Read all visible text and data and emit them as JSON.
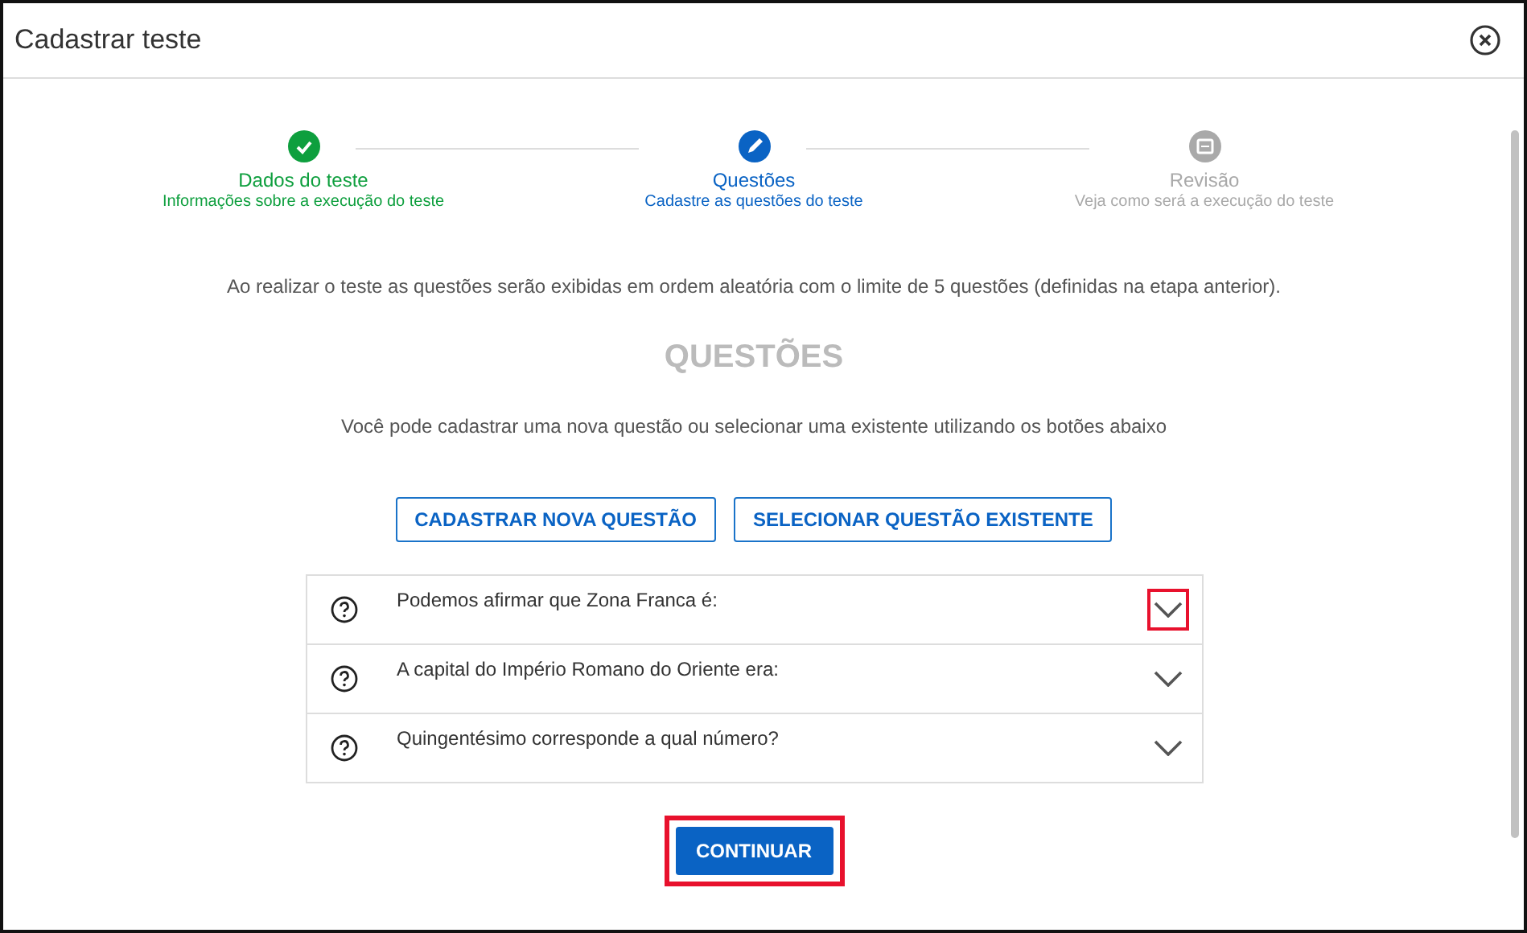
{
  "window": {
    "title": "Cadastrar teste"
  },
  "steps": [
    {
      "title": "Dados do teste",
      "subtitle": "Informações sobre a execução do teste",
      "kind": "done"
    },
    {
      "title": "Questões",
      "subtitle": "Cadastre as questões do teste",
      "kind": "current"
    },
    {
      "title": "Revisão",
      "subtitle": "Veja como será a execução do teste",
      "kind": "pending"
    }
  ],
  "info": "Ao realizar o teste as questões serão exibidas em ordem aleatória com o limite de 5 questões (definidas na etapa anterior).",
  "heading": "QUESTÕES",
  "hint": "Você pode cadastrar uma nova questão ou selecionar uma existente utilizando os botões abaixo",
  "buttons": [
    "CADASTRAR NOVA QUESTÃO",
    "SELECIONAR QUESTÃO EXISTENTE"
  ],
  "questions": [
    {
      "text": "Podemos afirmar que Zona Franca é:",
      "highlighted": true
    },
    {
      "text": "A capital do Império Romano do Oriente era:",
      "highlighted": false
    },
    {
      "text": "Quingentésimo corresponde a qual número?",
      "highlighted": false
    }
  ],
  "continue": {
    "label": "CONTINUAR",
    "highlighted": true
  }
}
